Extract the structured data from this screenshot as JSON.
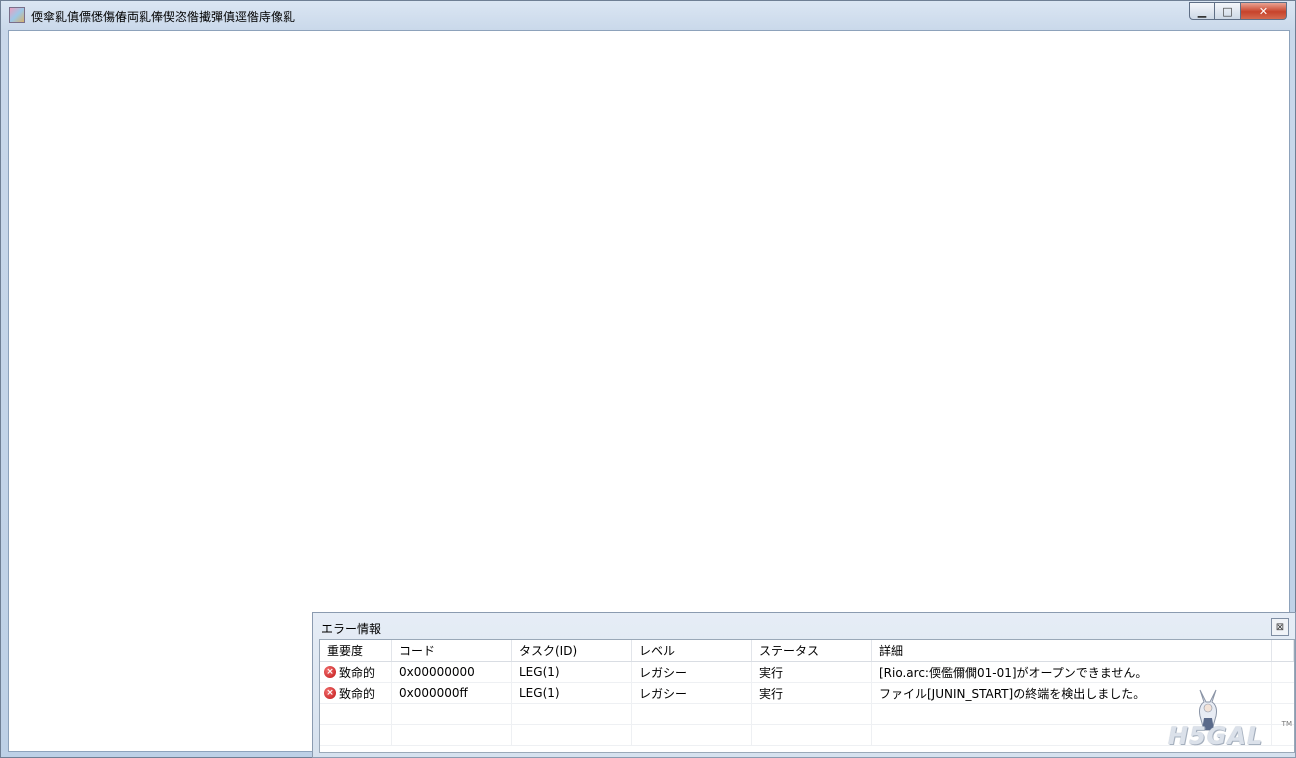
{
  "window": {
    "title": "偄傘乿傎僄僁傷偆両乿俸偰恣偺擮彈傎逕偺庤像乿",
    "minimize_glyph": "▁",
    "maximize_glyph": "□",
    "close_glyph": "✕"
  },
  "error_panel": {
    "title": "エラー情報",
    "close_glyph": "⊠",
    "columns": [
      "重要度",
      "コード",
      "タスク(ID)",
      "レベル",
      "ステータス",
      "詳細"
    ],
    "rows": [
      {
        "severity": "致命的",
        "code": "0x00000000",
        "task": "LEG(1)",
        "level": "レガシー",
        "status": "実行",
        "detail": "[Rio.arc:偄儖儞僩01-01]がオープンできません。"
      },
      {
        "severity": "致命的",
        "code": "0x000000ff",
        "task": "LEG(1)",
        "level": "レガシー",
        "status": "実行",
        "detail": "ファイル[JUNIN_START]の終端を検出しました。"
      }
    ],
    "severity_icon": "error-icon"
  },
  "watermark": {
    "text": "H5GAL",
    "tm": "TM"
  },
  "colors": {
    "accent_close": "#c7432b",
    "frame": "#bdd0e6",
    "error_icon": "#c01818"
  }
}
